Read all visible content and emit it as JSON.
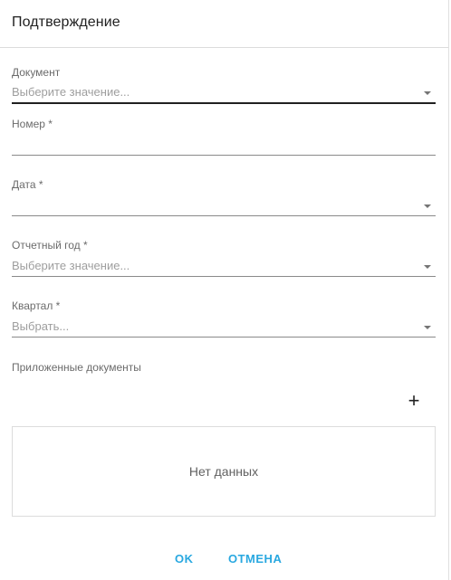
{
  "dialog": {
    "title": "Подтверждение"
  },
  "fields": {
    "document": {
      "label": "Документ",
      "placeholder": "Выберите значение..."
    },
    "number": {
      "label": "Номер *",
      "value": ""
    },
    "date": {
      "label": "Дата *",
      "value": ""
    },
    "report_year": {
      "label": "Отчетный год *",
      "placeholder": "Выберите значение..."
    },
    "quarter": {
      "label": "Квартал *",
      "placeholder": "Выбрать..."
    }
  },
  "attachments": {
    "label": "Приложенные документы",
    "add_glyph": "+",
    "empty_text": "Нет данных"
  },
  "actions": {
    "ok_label": "OK",
    "cancel_label": "ОТМЕНА"
  },
  "icons": {
    "dropdown": "chevron-down-icon",
    "add": "plus-icon"
  },
  "colors": {
    "accent": "#29a8e0",
    "text": "#212121",
    "muted": "#9e9e9e"
  }
}
